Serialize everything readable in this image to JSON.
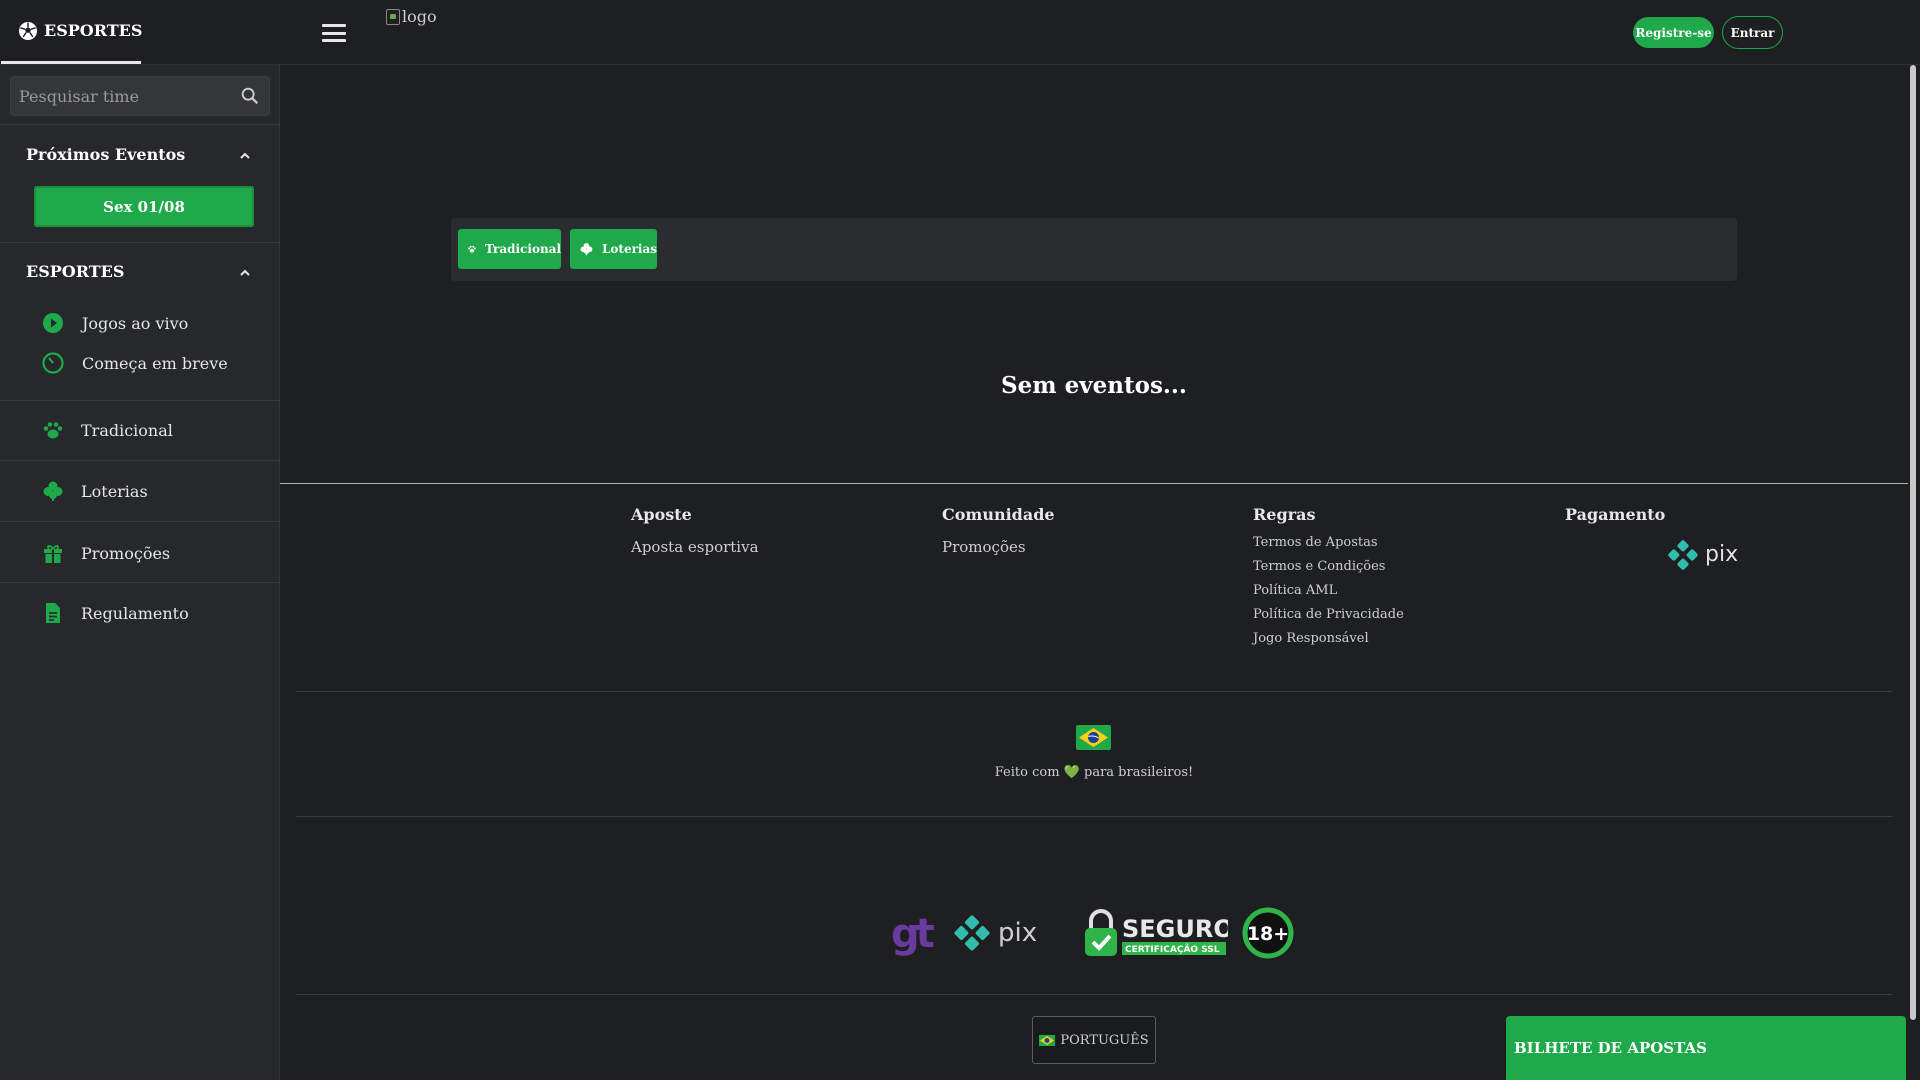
{
  "header": {
    "sports_tab": "ESPORTES",
    "logo_alt": "logo",
    "register_label": "Registre-se",
    "login_label": "Entrar"
  },
  "sidebar": {
    "search_placeholder": "Pesquisar time",
    "upcoming_title": "Próximos Eventos",
    "upcoming_date": "Sex  01/08",
    "sports_title": "ESPORTES",
    "items": [
      {
        "label": "Jogos ao vivo",
        "icon": "play-circle-icon"
      },
      {
        "label": "Começa em breve",
        "icon": "timer-icon"
      },
      {
        "label": "Tradicional",
        "icon": "paw-icon"
      },
      {
        "label": "Loterias",
        "icon": "clover-icon"
      },
      {
        "label": "Promoções",
        "icon": "gift-icon"
      },
      {
        "label": "Regulamento",
        "icon": "document-icon"
      }
    ]
  },
  "main": {
    "tabs": [
      {
        "label": "Tradicional",
        "icon": "paw-icon"
      },
      {
        "label": "Loterias",
        "icon": "clover-icon"
      }
    ],
    "empty_message": "Sem eventos..."
  },
  "footer": {
    "col_aposte": {
      "title": "Aposte",
      "links": [
        "Aposta esportiva"
      ]
    },
    "col_comunidade": {
      "title": "Comunidade",
      "links": [
        "Promoções"
      ]
    },
    "col_regras": {
      "title": "Regras",
      "links": [
        "Termos de Apostas",
        "Termos e Condições",
        "Política AML",
        "Política de Privacidade",
        "Jogo Responsável"
      ]
    },
    "col_pagamento": {
      "title": "Pagamento"
    },
    "made_with_prefix": "Feito com",
    "made_with_suffix": "para brasileiros!",
    "badge_gt": "gt",
    "badge_pix": "pix",
    "badge_seguro": "SEGURO",
    "badge_ssl": "CERTIFICAÇÃO SSL",
    "badge_age": "18+",
    "language": "PORTUGUÊS"
  },
  "bet_slip": {
    "title": "BILHETE DE APOSTAS"
  },
  "colors": {
    "accent": "#1fa94a",
    "background": "#1e1f21",
    "sidebar": "#26282b"
  }
}
